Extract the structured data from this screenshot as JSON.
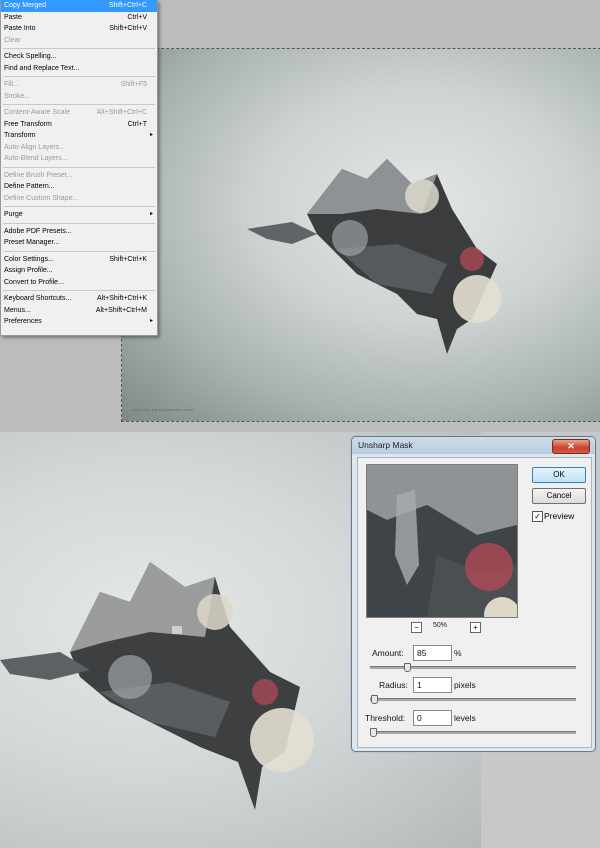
{
  "edit_menu": {
    "items": [
      {
        "label": "Copy Merged",
        "shortcut": "Shift+Ctrl+C",
        "state": "highlighted"
      },
      {
        "label": "Paste",
        "shortcut": "Ctrl+V",
        "state": "enabled"
      },
      {
        "label": "Paste Into",
        "shortcut": "Shift+Ctrl+V",
        "state": "enabled"
      },
      {
        "label": "Clear",
        "shortcut": "",
        "state": "disabled"
      },
      {
        "separator": true
      },
      {
        "label": "Check Spelling...",
        "shortcut": "",
        "state": "enabled"
      },
      {
        "label": "Find and Replace Text...",
        "shortcut": "",
        "state": "enabled"
      },
      {
        "separator": true
      },
      {
        "label": "Fill...",
        "shortcut": "Shift+F5",
        "state": "disabled"
      },
      {
        "label": "Stroke...",
        "shortcut": "",
        "state": "disabled"
      },
      {
        "separator": true
      },
      {
        "label": "Content-Aware Scale",
        "shortcut": "Alt+Shift+Ctrl+C",
        "state": "disabled"
      },
      {
        "label": "Free Transform",
        "shortcut": "Ctrl+T",
        "state": "enabled"
      },
      {
        "label": "Transform",
        "shortcut": "",
        "state": "enabled",
        "submenu": true
      },
      {
        "label": "Auto-Align Layers...",
        "shortcut": "",
        "state": "disabled"
      },
      {
        "label": "Auto-Blend Layers...",
        "shortcut": "",
        "state": "disabled"
      },
      {
        "separator": true
      },
      {
        "label": "Define Brush Preset...",
        "shortcut": "",
        "state": "disabled"
      },
      {
        "label": "Define Pattern...",
        "shortcut": "",
        "state": "enabled"
      },
      {
        "label": "Define Custom Shape...",
        "shortcut": "",
        "state": "disabled"
      },
      {
        "separator": true
      },
      {
        "label": "Purge",
        "shortcut": "",
        "state": "enabled",
        "submenu": true
      },
      {
        "separator": true
      },
      {
        "label": "Adobe PDF Presets...",
        "shortcut": "",
        "state": "enabled"
      },
      {
        "label": "Preset Manager...",
        "shortcut": "",
        "state": "enabled"
      },
      {
        "separator": true
      },
      {
        "label": "Color Settings...",
        "shortcut": "Shift+Ctrl+K",
        "state": "enabled"
      },
      {
        "label": "Assign Profile...",
        "shortcut": "",
        "state": "enabled"
      },
      {
        "label": "Convert to Profile...",
        "shortcut": "",
        "state": "enabled"
      },
      {
        "separator": true
      },
      {
        "label": "Keyboard Shortcuts...",
        "shortcut": "Alt+Shift+Ctrl+K",
        "state": "enabled"
      },
      {
        "label": "Menus...",
        "shortcut": "Alt+Shift+Ctrl+M",
        "state": "enabled"
      },
      {
        "label": "Preferences",
        "shortcut": "",
        "state": "enabled",
        "submenu": true
      }
    ],
    "submenu_arrow": "▸"
  },
  "canvas_top": {
    "credit_text": "CHILLING ON A SLEEPING GIANT"
  },
  "dialog": {
    "title": "Unsharp Mask",
    "close_glyph": "✕",
    "ok_label": "OK",
    "cancel_label": "Cancel",
    "preview_label": "Preview",
    "preview_checked_glyph": "✓",
    "zoom_out_glyph": "−",
    "zoom_in_glyph": "+",
    "zoom_level": "50%",
    "amount": {
      "label": "Amount:",
      "value": "85",
      "unit": "%",
      "slider_fraction": 0.17
    },
    "radius": {
      "label": "Radius:",
      "value": "1",
      "unit": "pixels",
      "slider_fraction": 0.003
    },
    "threshold": {
      "label": "Threshold:",
      "value": "0",
      "unit": "levels",
      "slider_fraction": 0.0
    }
  },
  "colors": {
    "menu_highlight": "#3399ff",
    "close_button": "#c7412b",
    "ok_button": "#bde3f8"
  }
}
